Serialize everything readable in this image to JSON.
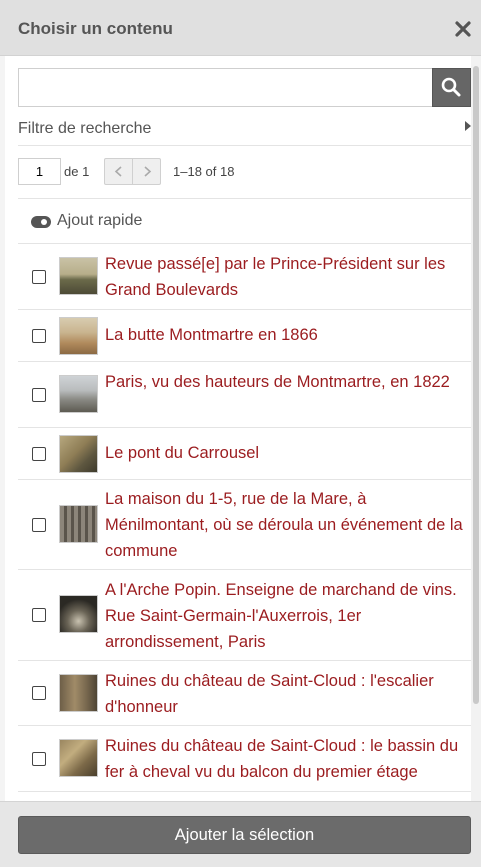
{
  "header": {
    "title": "Choisir un contenu",
    "close_icon": "close-icon"
  },
  "search": {
    "value": "",
    "placeholder": "",
    "button_icon": "search-icon"
  },
  "filter": {
    "label": "Filtre de recherche",
    "icon": "caret-right-icon"
  },
  "pager": {
    "page": "1",
    "of_label": "de 1",
    "range": "1–18 of 18"
  },
  "quick_add": {
    "label": "Ajout rapide",
    "icon": "toggle-icon"
  },
  "items": [
    {
      "title": "Revue passé[e] par le Prince-Président sur les Grand Boulevards"
    },
    {
      "title": "La butte Montmartre en 1866"
    },
    {
      "title": "Paris, vu des hauteurs de Montmartre, en 1822"
    },
    {
      "title": "Le pont du Carrousel"
    },
    {
      "title": "La maison du 1-5, rue de la Mare, à Ménilmontant, où se déroula un événement de la commune"
    },
    {
      "title": "A l'Arche Popin. Enseigne de marchand de vins. Rue Saint-Germain-l'Auxerrois, 1er arrondissement, Paris"
    },
    {
      "title": "Ruines du château de Saint-Cloud : l'escalier d'honneur"
    },
    {
      "title": "Ruines du château de Saint-Cloud : le bassin du fer à cheval vu du balcon du premier étage"
    }
  ],
  "footer": {
    "add_label": "Ajouter la sélection"
  },
  "colors": {
    "link": "#9b1c1f",
    "header_bg": "#e0e0e0",
    "button_bg": "#6b6b6b"
  }
}
